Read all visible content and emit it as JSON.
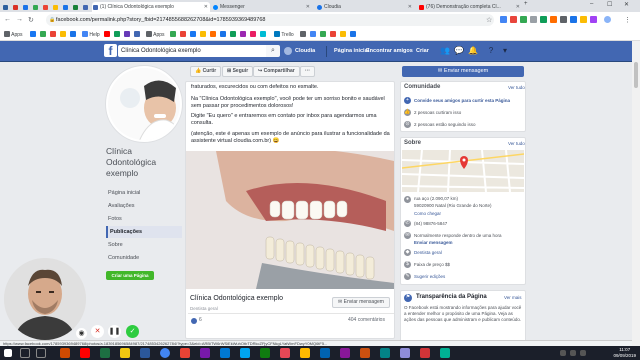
{
  "browser": {
    "tabs": [
      {
        "label": "",
        "color": "#2c5f9e"
      },
      {
        "label": "",
        "color": "#d93025"
      },
      {
        "label": "",
        "color": "#1a73e8"
      },
      {
        "label": "",
        "color": "#34a853"
      },
      {
        "label": "",
        "color": "#ea4335"
      },
      {
        "label": "",
        "color": "#fbbc04"
      },
      {
        "label": "",
        "color": "#1a73e8"
      },
      {
        "label": "",
        "color": "#188038"
      },
      {
        "label": "",
        "color": "#4267b2"
      },
      {
        "label": "(1) Clínica Odontológica exemplo",
        "color": "#4267b2"
      },
      {
        "label": "Messenger",
        "color": "#0084ff"
      },
      {
        "label": "Cloudia",
        "color": "#1a73e8"
      },
      {
        "label": "(76) Demonstração completa Cl...",
        "color": "#ff0000"
      }
    ],
    "url": "facebook.com/permalink.php?story_fbid=2174855688262708&id=1785939369489768",
    "bookmarks": [
      "Apps",
      "",
      "",
      "",
      "",
      "",
      "Help",
      "",
      "",
      "",
      "",
      "Apps",
      "",
      "",
      "",
      "",
      "",
      "",
      "",
      "",
      "",
      "",
      "Trello",
      "",
      "",
      "",
      "",
      "",
      ""
    ]
  },
  "fb": {
    "search_value": "Clínica Odontológica exemplo",
    "user": "Cloudia",
    "nav": [
      "Página inicial",
      "Encontrar amigos",
      "Criar"
    ]
  },
  "page": {
    "name": "Clínica Odontológica exemplo",
    "nav": [
      "Página inicial",
      "Avaliações",
      "Fotos",
      "Publicações",
      "Sobre",
      "Comunidade"
    ],
    "active_nav": "Publicações",
    "create_page": "Criar uma Página"
  },
  "actions": {
    "like": "Curtir",
    "follow": "Seguir",
    "share": "Compartilhar",
    "more": "···"
  },
  "post": {
    "line1": "fraturados, escurecidos ou com defeitos no esmalte.",
    "para1": "Na \"Clínica Odontológica exemplo\", você pode ter um sorriso bonito e saudável sem passar por procedimentos dolorosos!",
    "para2": "Digite \"Eu quero\" e entraremos em contato por inbox para agendarmos uma consulta.",
    "para3": "(atenção, este é apenas um exemplo de anúncio para ilustrar a funcionalidade da assistente virtual cloudia.com.br) 😀",
    "ad_title": "Clínica Odontológica exemplo",
    "ad_subtitle": "Dentista geral",
    "message_button": "Enviar mensagem",
    "likes": "6",
    "comments": "404 comentários"
  },
  "sidebar": {
    "send_message": "Enviar mensagem",
    "community": {
      "title": "Comunidade",
      "see_all": "Ver tudo",
      "invite": "Convide seus amigos para curtir esta Página",
      "likes": "2 pessoas curtiram isso",
      "follows": "2 pessoas estão seguindo isso"
    },
    "about": {
      "title": "Sobre",
      "see_all": "Ver tudo",
      "address1": "rua aço (2.090,07 km)",
      "address2": "59020900 Natal (Rio Grande do Norte)",
      "directions": "Como chegar",
      "phone": "(84) 98876-5847",
      "response": "Normalmente responde dentro de uma hora",
      "send": "Enviar mensagem",
      "category": "Dentista geral",
      "price": "Faixa de preço $$",
      "edit": "Sugerir edições"
    },
    "transparency": {
      "title": "Transparência da Página",
      "see_more": "Ver mais",
      "text": "O Facebook está mostrando informações para ajudar você a entender melhor o propósito de uma Página. Veja as ações das pessoas que administram e publicam conteúdo."
    }
  },
  "statusbar": "https://www.facebook.com/1785939369489768/photos/a.1839185696584987/2174853426262784/?type=3&eid=ARBiTW6rWSiEkWuhOtbTDRkcZFjyCFNkgLYatWmFDwyY0MQ6tF5...",
  "taskbar": {
    "time": "11:07",
    "date": "09/09/2019"
  }
}
